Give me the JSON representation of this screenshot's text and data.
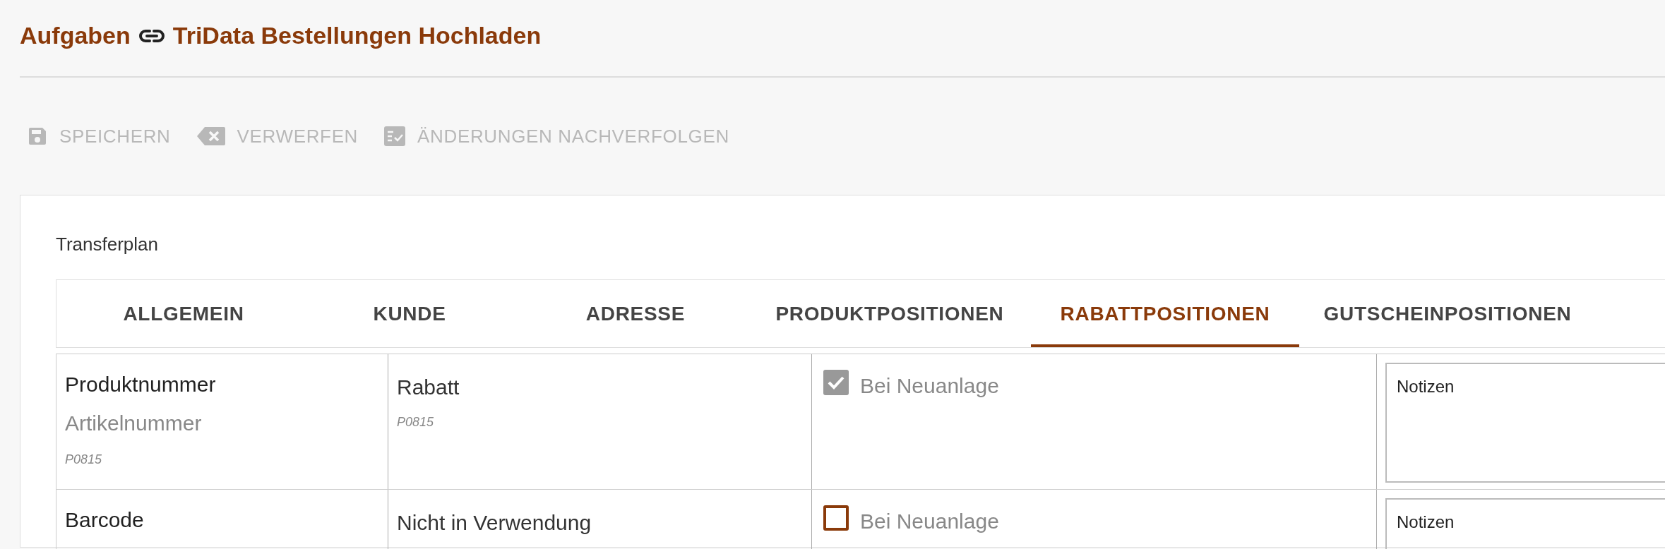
{
  "breadcrumb": {
    "parent": "Aufgaben",
    "current": "TriData Bestellungen Hochladen"
  },
  "toolbar": [
    {
      "kind": "save",
      "label": "SPEICHERN",
      "disabled": true
    },
    {
      "kind": "discard",
      "label": "VERWERFEN",
      "disabled": true
    },
    {
      "kind": "track",
      "label": "ÄNDERUNGEN NACHVERFOLGEN",
      "disabled": true
    }
  ],
  "card": {
    "title": "Transferplan",
    "tabs": [
      {
        "label": "ALLGEMEIN",
        "selected": false
      },
      {
        "label": "KUNDE",
        "selected": false
      },
      {
        "label": "ADRESSE",
        "selected": false
      },
      {
        "label": "PRODUKTPOSITIONEN",
        "selected": false
      },
      {
        "label": "RABATTPOSITIONEN",
        "selected": true
      },
      {
        "label": "GUTSCHEINPOSITIONEN",
        "selected": false
      }
    ],
    "rows": [
      {
        "source": "Produktnummer",
        "source_alias": "Artikelnummer",
        "source_code": "P0815",
        "target": "Rabatt",
        "target_code": "P0815",
        "option": "Bei Neuanlage",
        "checked": true,
        "notes_placeholder": "Notizen"
      },
      {
        "source": "Barcode",
        "target": "Nicht in Verwendung",
        "option": "Bei Neuanlage",
        "checked": false,
        "notes_placeholder": "Notizen"
      }
    ]
  }
}
